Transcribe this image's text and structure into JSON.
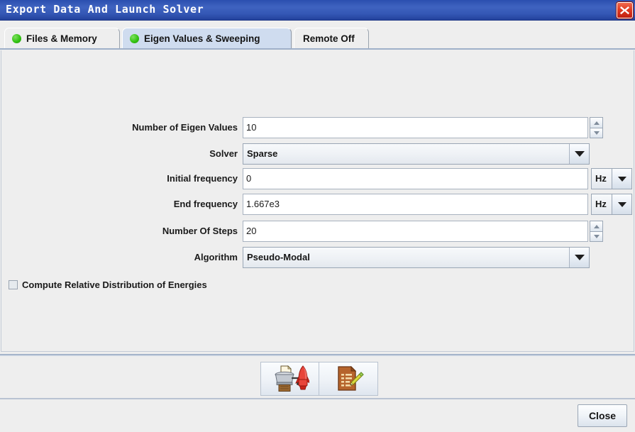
{
  "window": {
    "title": "Export Data And Launch Solver",
    "close_icon": "close-x-icon"
  },
  "tabs": [
    {
      "label": "Files & Memory",
      "selected": false,
      "status_dot": "green-dot-icon"
    },
    {
      "label": "Eigen Values & Sweeping",
      "selected": true,
      "status_dot": "green-dot-icon"
    },
    {
      "label": "Remote Off",
      "selected": false,
      "status_dot": null
    }
  ],
  "form": {
    "eigen_values": {
      "label": "Number of Eigen Values",
      "value": "10",
      "spinner_up_icon": "triangle-up-icon",
      "spinner_down_icon": "triangle-down-icon"
    },
    "solver": {
      "label": "Solver",
      "value": "Sparse",
      "arrow_icon": "chevron-down-icon"
    },
    "initial_frequency": {
      "label": "Initial frequency",
      "value": "0",
      "unit": "Hz",
      "unit_arrow_icon": "chevron-down-icon"
    },
    "end_frequency": {
      "label": "End frequency",
      "value": "1.667e3",
      "unit": "Hz",
      "unit_arrow_icon": "chevron-down-icon"
    },
    "number_of_steps": {
      "label": "Number Of Steps",
      "value": "20",
      "spinner_up_icon": "triangle-up-icon",
      "spinner_down_icon": "triangle-down-icon"
    },
    "algorithm": {
      "label": "Algorithm",
      "value": "Pseudo-Modal",
      "arrow_icon": "chevron-down-icon"
    },
    "compute_energies": {
      "label": "Compute Relative Distribution of Energies",
      "checked": false
    }
  },
  "toolbar": {
    "export_launch_icon": "export-and-launch-rocket-icon",
    "edit_file_icon": "document-with-pencil-icon"
  },
  "footer": {
    "close_label": "Close"
  },
  "colors": {
    "titlebar": "#3457b5",
    "accent_close": "#d42d17",
    "tab_selected": "#cfdcef",
    "panel": "#eeeeee",
    "status_dot": "#35c413"
  }
}
